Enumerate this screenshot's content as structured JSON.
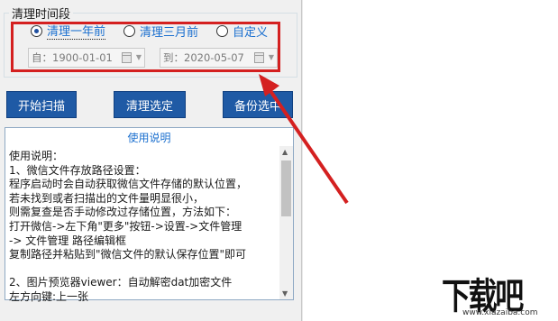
{
  "period_group": {
    "title": "清理时间段",
    "options": [
      {
        "label": "清理一年前",
        "checked": true
      },
      {
        "label": "清理三月前",
        "checked": false
      },
      {
        "label": "自定义",
        "checked": false
      }
    ],
    "from_value": "自：1900-01-01",
    "to_value": "到：2020-05-07"
  },
  "buttons": {
    "scan": "开始扫描",
    "clean": "清理选定",
    "backup": "备份选中"
  },
  "description": {
    "title": "使用说明",
    "text": "使用说明：\n1、微信文件存放路径设置：\n程序启动时会自动获取微信文件存储的默认位置，\n若未找到或者扫描出的文件量明显很小，\n则需复查是否手动修改过存储位置，方法如下：\n打开微信->左下角\"更多\"按钮->设置->文件管理\n-> 文件管理 路径编辑框\n复制路径并粘贴到\"微信文件的默认保存位置\"即可\n\n2、图片预览器viewer：自动解密dat加密文件\n左方向键:上一张"
  },
  "colors": {
    "button_blue": "#1f5aa5",
    "highlight_red": "#d42020",
    "link_blue": "#1a6fcf"
  },
  "watermark": {
    "text": "下载吧",
    "url": "www.xiazaiba.com"
  }
}
